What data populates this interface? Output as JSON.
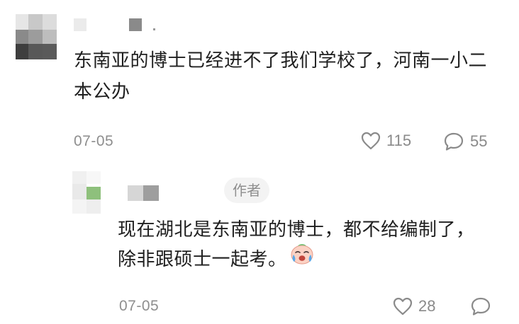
{
  "comment": {
    "text": "东南亚的博士已经进不了我们学校了，河南一小二本公办",
    "date": "07-05",
    "likes": "115",
    "replies": "55",
    "icons": {
      "like": "heart-outline-icon",
      "reply": "speech-bubble-icon"
    }
  },
  "reply": {
    "badge": "作者",
    "text": "现在湖北是东南亚的博士，都不给编制了，除非跟硕士一起考。",
    "emoji": "crying-face-emoji",
    "date": "07-05",
    "likes": "28",
    "icons": {
      "like": "heart-outline-icon",
      "reply": "speech-bubble-icon"
    }
  },
  "colors": {
    "text": "#1f1f1f",
    "meta": "#8e8e8e",
    "badge_bg": "#f3f3f3",
    "avatar_green": "#8ec07c"
  }
}
